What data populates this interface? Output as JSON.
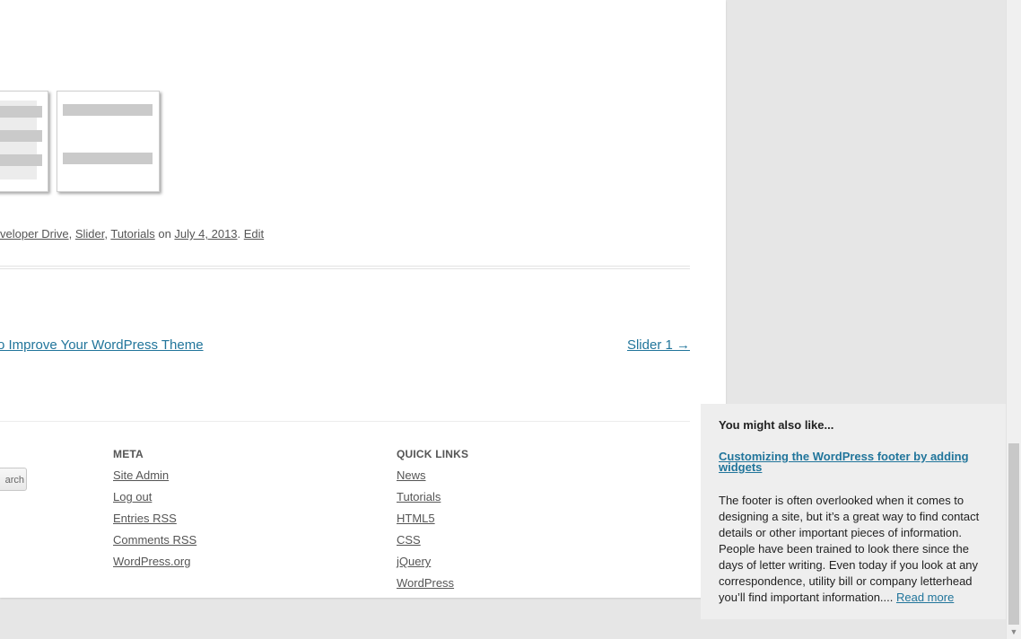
{
  "post": {
    "meta_line": {
      "cat_partial": "veloper Drive",
      "sep1": ", ",
      "cat_slider": "Slider",
      "sep2": ", ",
      "cat_tutorials": "Tutorials",
      "on_text": " on ",
      "date": "July 4, 2013",
      "dot": ". ",
      "edit": "Edit"
    }
  },
  "post_nav": {
    "prev": "o Improve Your WordPress Theme",
    "next": "Slider 1 →"
  },
  "footer": {
    "search_button": "arch",
    "meta": {
      "title": "META",
      "items": [
        "Site Admin",
        "Log out",
        "Entries RSS",
        "Comments RSS",
        "WordPress.org"
      ]
    },
    "quick_links": {
      "title": "QUICK LINKS",
      "items": [
        "News",
        "Tutorials",
        "HTML5",
        "CSS",
        "jQuery",
        "WordPress"
      ]
    }
  },
  "related_popup": {
    "heading": "You might also like...",
    "title": "Customizing the WordPress footer by adding widgets",
    "excerpt": "The footer is often overlooked when it comes to designing a site, but it’s a great way to find contact details or other important pieces of information. People have been trained to look there since the days of letter writing. Even today if you look at any correspondence, utility bill or company letterhead you’ll find important information.... ",
    "read_more": "Read more"
  },
  "colors": {
    "link_blue": "#21759b",
    "page_bg": "#e6e6e6",
    "popup_bg": "#eeeeee"
  },
  "icons": {
    "scroll_down": "arrow-down-icon"
  }
}
